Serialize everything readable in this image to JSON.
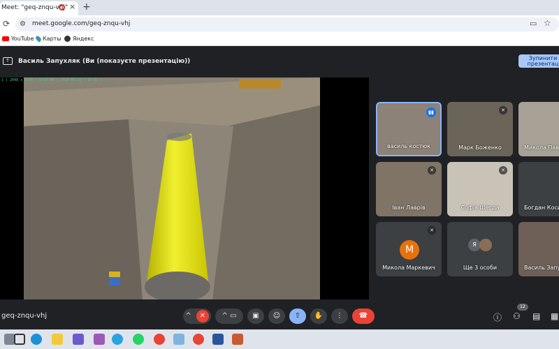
{
  "browser": {
    "tab_title": "Meet: \"geq-znqu-vhj\"",
    "tab_close": "×",
    "new_tab": "+",
    "url": "meet.google.com/geq-znqu-vhj",
    "bookmarks": [
      "YouTube",
      "Карты",
      "Яндекс"
    ]
  },
  "meet": {
    "presenter_title": "Василь Запухляк (Ви (показуєте презентацію))",
    "stop_button": "Зупинити презентац",
    "overlay_text": "1 ( 2048 x 1536 ~ 0.16 MB ~ 2018-05-22 ~ 10:52 )",
    "meeting_code": "geq-znqu-vhj",
    "participants_count": "12",
    "participants": [
      {
        "name": "василь костюк",
        "muted": false,
        "speaking": true
      },
      {
        "name": "Марк Боженко",
        "muted": true
      },
      {
        "name": "Микола Павл",
        "muted": false
      },
      {
        "name": "Іван Лаврів",
        "muted": true
      },
      {
        "name": "Софія Шегда",
        "muted": true
      },
      {
        "name": "Богдан Коси",
        "muted": false
      },
      {
        "name": "Микола Маркевич",
        "muted": true,
        "initial": "M"
      },
      {
        "name": "Ще 3 особи",
        "mini_initial": "Я"
      },
      {
        "name": "Василь Запу",
        "muted": false
      }
    ]
  },
  "colors": {
    "meet_bg": "#202124",
    "tile_bg": "#3c4043",
    "end_call_red": "#ea4335",
    "present_blue": "#8ab4f8",
    "stop_button_bg": "#a8c7fa",
    "speaking_blue": "#1a73e8"
  }
}
